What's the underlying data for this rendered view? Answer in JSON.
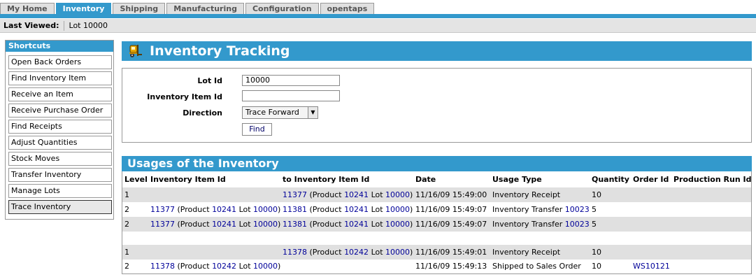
{
  "tabs": [
    "My Home",
    "Inventory",
    "Shipping",
    "Manufacturing",
    "Configuration",
    "opentaps"
  ],
  "active_tab": "Inventory",
  "last_viewed": {
    "label": "Last Viewed:",
    "item": "Lot 10000"
  },
  "shortcuts": {
    "title": "Shortcuts",
    "items": [
      "Open Back Orders",
      "Find Inventory Item",
      "Receive an Item",
      "Receive Purchase Order",
      "Find Receipts",
      "Adjust Quantities",
      "Stock Moves",
      "Transfer Inventory",
      "Manage Lots",
      "Trace Inventory"
    ],
    "active": "Trace Inventory"
  },
  "tracking": {
    "title": "Inventory Tracking",
    "icon": "forklift-icon"
  },
  "form": {
    "lot_label": "Lot Id",
    "lot_value": "10000",
    "item_label": "Inventory Item Id",
    "item_value": "",
    "direction_label": "Direction",
    "direction_value": "Trace Forward",
    "find_label": "Find"
  },
  "usages": {
    "title": "Usages of the Inventory",
    "columns": [
      "Level",
      "Inventory Item Id",
      "to Inventory Item Id",
      "Date",
      "Usage Type",
      "Quantity",
      "Order Id",
      "Production Run Id"
    ],
    "rows": [
      {
        "level": "1",
        "from_id": "",
        "from_product": "",
        "from_lot": "",
        "to_id": "11377",
        "to_product": "10241",
        "to_lot": "10000",
        "date": "11/16/09 15:49:00",
        "usage_type": "Inventory Receipt",
        "usage_ref": "",
        "quantity": "10",
        "order_id": "",
        "production_run_id": ""
      },
      {
        "level": "2",
        "from_id": "11377",
        "from_product": "10241",
        "from_lot": "10000",
        "to_id": "11381",
        "to_product": "10241",
        "to_lot": "10000",
        "date": "11/16/09 15:49:07",
        "usage_type": "Inventory Transfer",
        "usage_ref": "10023",
        "quantity": "5",
        "order_id": "",
        "production_run_id": ""
      },
      {
        "level": "2",
        "from_id": "11377",
        "from_product": "10241",
        "from_lot": "10000",
        "to_id": "11381",
        "to_product": "10241",
        "to_lot": "10000",
        "date": "11/16/09 15:49:07",
        "usage_type": "Inventory Transfer",
        "usage_ref": "10023",
        "quantity": "5",
        "order_id": "",
        "production_run_id": ""
      },
      {
        "level": "1",
        "from_id": "",
        "from_product": "",
        "from_lot": "",
        "to_id": "11378",
        "to_product": "10242",
        "to_lot": "10000",
        "date": "11/16/09 15:49:01",
        "usage_type": "Inventory Receipt",
        "usage_ref": "",
        "quantity": "10",
        "order_id": "",
        "production_run_id": ""
      },
      {
        "level": "2",
        "from_id": "11378",
        "from_product": "10242",
        "from_lot": "10000",
        "to_id": "",
        "to_product": "",
        "to_lot": "",
        "date": "11/16/09 15:49:13",
        "usage_type": "Shipped to Sales Order",
        "usage_ref": "",
        "quantity": "10",
        "order_id": "WS10121",
        "production_run_id": ""
      }
    ],
    "text": {
      "product": "(Product",
      "lot": "Lot",
      "close": ")"
    }
  }
}
